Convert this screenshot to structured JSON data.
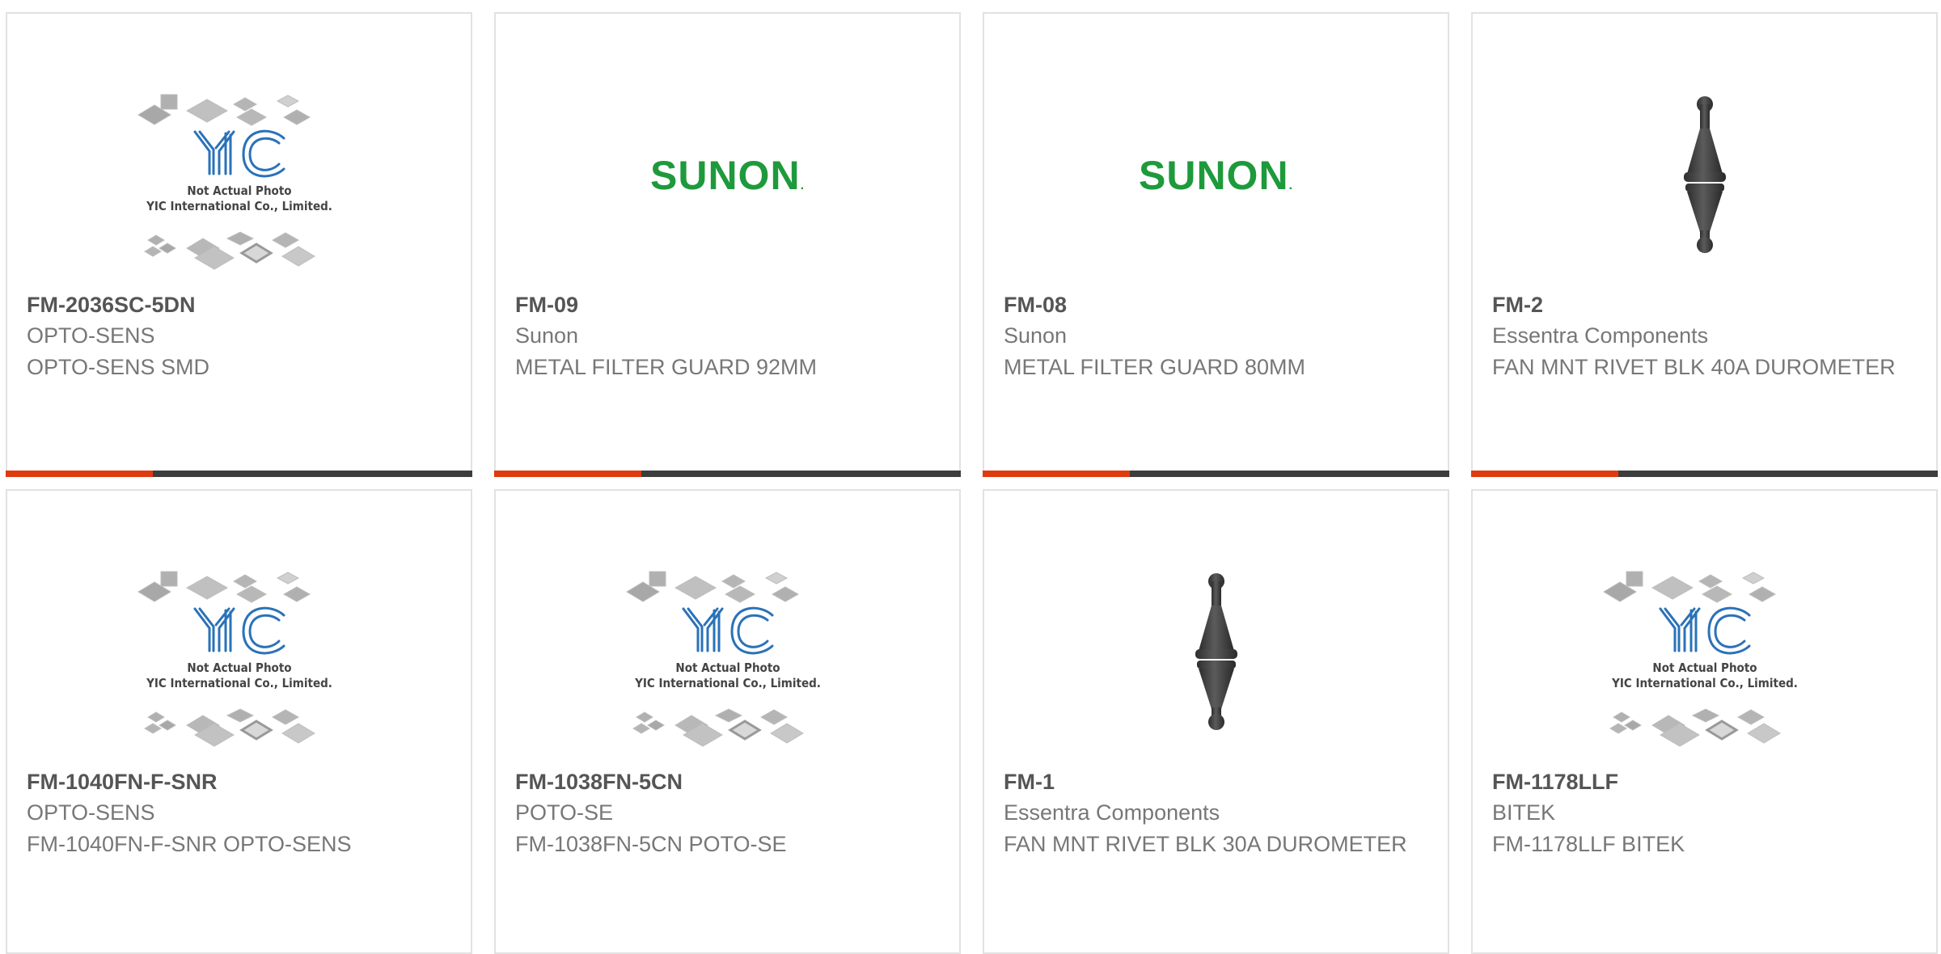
{
  "placeholder": {
    "line1": "Not Actual Photo",
    "line2": "YIC International Co., Limited."
  },
  "brand_logo": {
    "text": "SUNON",
    "dot": ".",
    "color": "#1e9a3c"
  },
  "colors": {
    "accent": "#e03a10",
    "bar": "#3d3d3d",
    "border": "#e2e2e2"
  },
  "products": [
    {
      "part_number": "FM-2036SC-5DN",
      "manufacturer": "OPTO-SENS",
      "description": "OPTO-SENS SMD",
      "image": "yic-placeholder"
    },
    {
      "part_number": "FM-09",
      "manufacturer": "Sunon",
      "description": "METAL FILTER GUARD 92MM",
      "image": "sunon-logo"
    },
    {
      "part_number": "FM-08",
      "manufacturer": "Sunon",
      "description": "METAL FILTER GUARD 80MM",
      "image": "sunon-logo"
    },
    {
      "part_number": "FM-2",
      "manufacturer": "Essentra Components",
      "description": "FAN MNT RIVET BLK 40A DUROMETER",
      "image": "rivet-photo"
    },
    {
      "part_number": "FM-1040FN-F-SNR",
      "manufacturer": "OPTO-SENS",
      "description": "FM-1040FN-F-SNR OPTO-SENS",
      "image": "yic-placeholder"
    },
    {
      "part_number": "FM-1038FN-5CN",
      "manufacturer": "POTO-SE",
      "description": "FM-1038FN-5CN POTO-SE",
      "image": "yic-placeholder"
    },
    {
      "part_number": "FM-1",
      "manufacturer": "Essentra Components",
      "description": "FAN MNT RIVET BLK 30A DUROMETER",
      "image": "rivet-photo"
    },
    {
      "part_number": "FM-1178LLF",
      "manufacturer": "BITEK",
      "description": "FM-1178LLF BITEK",
      "image": "yic-placeholder"
    }
  ]
}
